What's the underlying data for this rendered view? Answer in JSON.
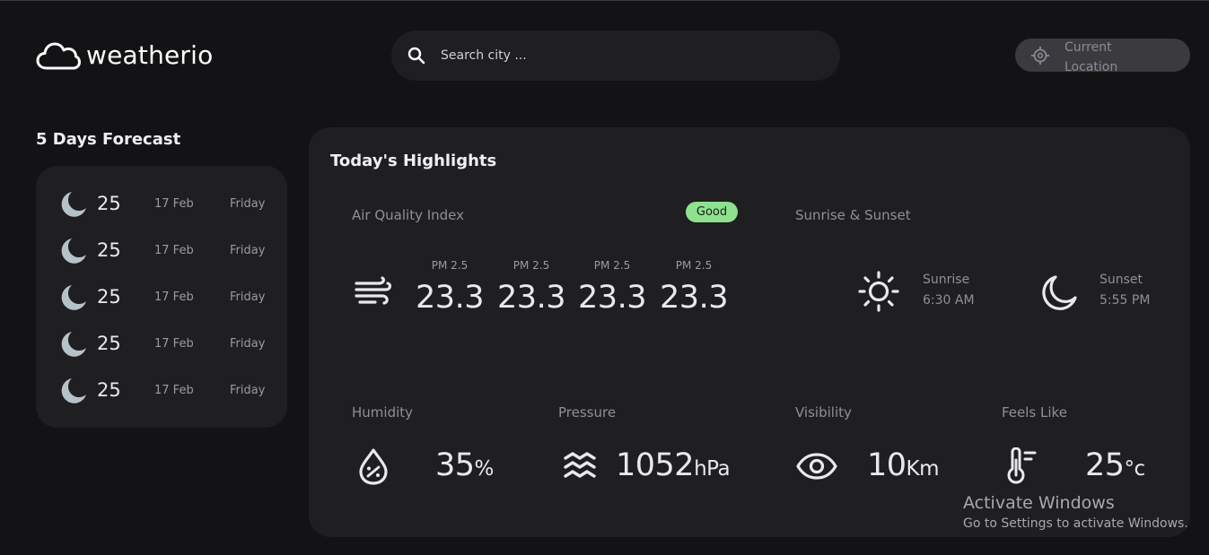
{
  "app": {
    "brand": "weatherio"
  },
  "search": {
    "placeholder": "Search city ..."
  },
  "location_button": {
    "label": "Current Location"
  },
  "forecast": {
    "title": "5 Days Forecast",
    "rows": [
      {
        "temp": "25",
        "date": "17 Feb",
        "day": "Friday",
        "icon": "moon-icon"
      },
      {
        "temp": "25",
        "date": "17 Feb",
        "day": "Friday",
        "icon": "moon-icon"
      },
      {
        "temp": "25",
        "date": "17 Feb",
        "day": "Friday",
        "icon": "moon-icon"
      },
      {
        "temp": "25",
        "date": "17 Feb",
        "day": "Friday",
        "icon": "moon-icon"
      },
      {
        "temp": "25",
        "date": "17 Feb",
        "day": "Friday",
        "icon": "moon-icon"
      }
    ]
  },
  "highlights": {
    "title": "Today's Highlights",
    "aqi": {
      "label": "Air Quality Index",
      "badge": "Good",
      "badge_color": "#8ee28f",
      "items": [
        {
          "label": "PM 2.5",
          "value": "23.3"
        },
        {
          "label": "PM 2.5",
          "value": "23.3"
        },
        {
          "label": "PM 2.5",
          "value": "23.3"
        },
        {
          "label": "PM 2.5",
          "value": "23.3"
        }
      ]
    },
    "sun": {
      "label": "Sunrise & Sunset",
      "sunrise_label": "Sunrise",
      "sunrise_time": "6:30 AM",
      "sunset_label": "Sunset",
      "sunset_time": "5:55 PM"
    },
    "humidity": {
      "label": "Humidity",
      "value": "35",
      "unit": "%"
    },
    "pressure": {
      "label": "Pressure",
      "value": "1052",
      "unit": "hPa"
    },
    "visibility": {
      "label": "Visibility",
      "value": "10",
      "unit": "Km"
    },
    "feels_like": {
      "label": "Feels Like",
      "value": "25",
      "unit": "°c"
    }
  },
  "watermark": {
    "title": "Activate Windows",
    "subtitle": "Go to Settings to activate Windows."
  },
  "colors": {
    "background": "#131315",
    "card": "#1f1f22",
    "moon_icon": "#b6c2c9",
    "good_badge": "#8ee28f"
  }
}
